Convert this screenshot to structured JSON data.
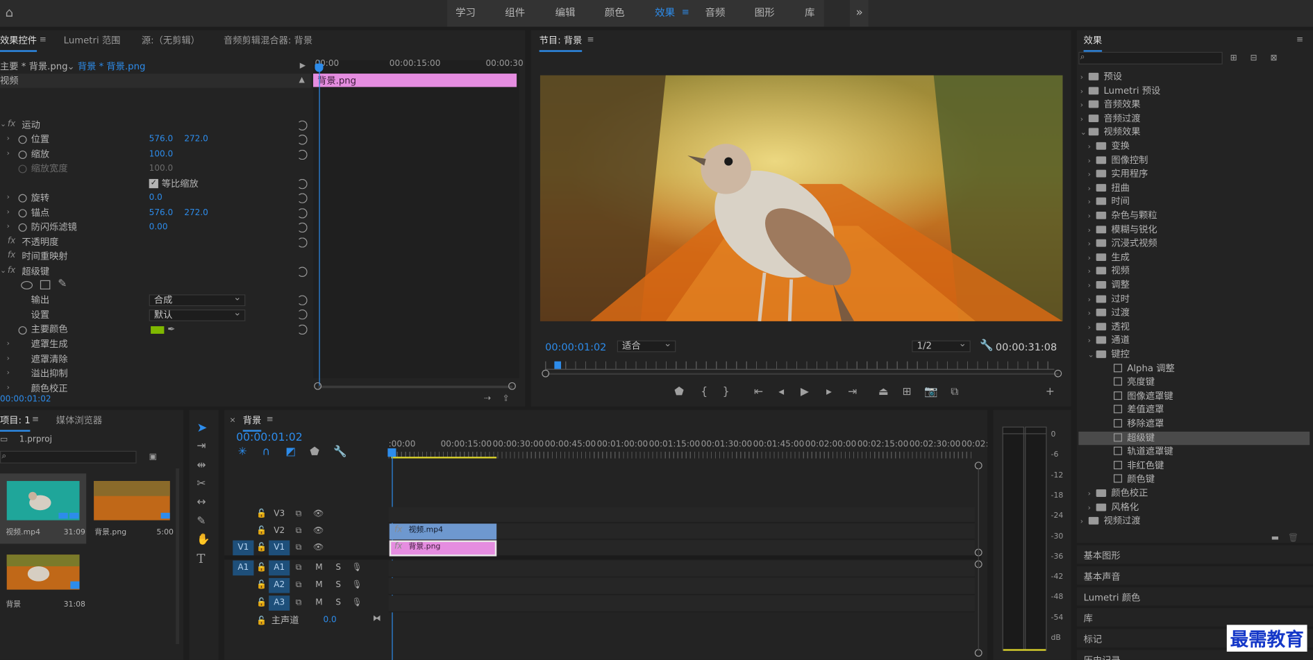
{
  "workspaces": [
    "学习",
    "组件",
    "编辑",
    "颜色",
    "效果",
    "音频",
    "图形",
    "库"
  ],
  "active_workspace": "效果",
  "more_workspaces": "»",
  "effect_controls": {
    "tabs": [
      "效果控件",
      "Lumetri 范围",
      "源:（无剪辑）",
      "音频剪辑混合器: 背景"
    ],
    "source_label": "主要 * 背景.png",
    "clip_label": "背景 * 背景.png",
    "ruler": [
      "00:00",
      "00:00:15:00",
      "00:00:30"
    ],
    "clip_bar": "背景.png",
    "section_video": "视频",
    "rows": [
      {
        "name": "运动",
        "fx": true
      },
      {
        "name": "位置",
        "v1": "576.0",
        "v2": "272.0"
      },
      {
        "name": "缩放",
        "v1": "100.0"
      },
      {
        "name": "缩放宽度",
        "v1": "100.0",
        "dim": true
      },
      {
        "name": "等比缩放",
        "checkbox": true
      },
      {
        "name": "旋转",
        "v1": "0.0"
      },
      {
        "name": "锚点",
        "v1": "576.0",
        "v2": "272.0"
      },
      {
        "name": "防闪烁滤镜",
        "v1": "0.00"
      },
      {
        "name": "不透明度",
        "fx": true
      },
      {
        "name": "时间重映射",
        "fx": true
      },
      {
        "name": "超级键",
        "fx": true
      }
    ],
    "output_label": "输出",
    "output_value": "合成",
    "setting_label": "设置",
    "setting_value": "默认",
    "key_color_label": "主要颜色",
    "sub_groups": [
      "遮罩生成",
      "遮罩清除",
      "溢出抑制",
      "颜色校正"
    ],
    "timecode": "00:00:01:02"
  },
  "program": {
    "title": "节目: 背景",
    "timecode": "00:00:01:02",
    "fit": "适合",
    "resolution": "1/2",
    "duration": "00:00:31:08"
  },
  "project": {
    "tabs": [
      "项目: 1",
      "媒体浏览器"
    ],
    "file": "1.prproj",
    "items": [
      {
        "name": "视频.mp4",
        "dur": "31:09"
      },
      {
        "name": "背景.png",
        "dur": "5:00"
      },
      {
        "name": "背景",
        "dur": "31:08"
      }
    ]
  },
  "timeline": {
    "tab": "背景",
    "timecode": "00:00:01:02",
    "ruler": [
      ":00:00",
      "00:00:15:00",
      "00:00:30:00",
      "00:00:45:00",
      "00:01:00:00",
      "00:01:15:00",
      "00:01:30:00",
      "00:01:45:00",
      "00:02:00:00",
      "00:02:15:00",
      "00:02:30:00",
      "00:02:45:"
    ],
    "video_tracks": [
      "V3",
      "V2",
      "V1"
    ],
    "audio_tracks": [
      "A1",
      "A2",
      "A3"
    ],
    "src_v": "V1",
    "src_a": "A1",
    "master": "主声道",
    "master_val": "0.0",
    "clip_video": "视频.mp4",
    "clip_png": "背景.png",
    "m": "M",
    "s": "S"
  },
  "meter": {
    "ticks": [
      "0",
      "-6",
      "-12",
      "-18",
      "-24",
      "-30",
      "-36",
      "-42",
      "-48",
      "-54",
      "dB"
    ]
  },
  "effects": {
    "title": "效果",
    "tree": [
      {
        "label": "预设",
        "lvl": 0,
        "t": "f",
        "o": false
      },
      {
        "label": "Lumetri 预设",
        "lvl": 0,
        "t": "f",
        "o": false
      },
      {
        "label": "音频效果",
        "lvl": 0,
        "t": "f",
        "o": false
      },
      {
        "label": "音频过渡",
        "lvl": 0,
        "t": "f",
        "o": false
      },
      {
        "label": "视频效果",
        "lvl": 0,
        "t": "f",
        "o": true
      },
      {
        "label": "变换",
        "lvl": 1,
        "t": "f",
        "o": false
      },
      {
        "label": "图像控制",
        "lvl": 1,
        "t": "f",
        "o": false
      },
      {
        "label": "实用程序",
        "lvl": 1,
        "t": "f",
        "o": false
      },
      {
        "label": "扭曲",
        "lvl": 1,
        "t": "f",
        "o": false
      },
      {
        "label": "时间",
        "lvl": 1,
        "t": "f",
        "o": false
      },
      {
        "label": "杂色与颗粒",
        "lvl": 1,
        "t": "f",
        "o": false
      },
      {
        "label": "模糊与锐化",
        "lvl": 1,
        "t": "f",
        "o": false
      },
      {
        "label": "沉浸式视频",
        "lvl": 1,
        "t": "f",
        "o": false
      },
      {
        "label": "生成",
        "lvl": 1,
        "t": "f",
        "o": false
      },
      {
        "label": "视频",
        "lvl": 1,
        "t": "f",
        "o": false
      },
      {
        "label": "调整",
        "lvl": 1,
        "t": "f",
        "o": false
      },
      {
        "label": "过时",
        "lvl": 1,
        "t": "f",
        "o": false
      },
      {
        "label": "过渡",
        "lvl": 1,
        "t": "f",
        "o": false
      },
      {
        "label": "透视",
        "lvl": 1,
        "t": "f",
        "o": false
      },
      {
        "label": "通道",
        "lvl": 1,
        "t": "f",
        "o": false
      },
      {
        "label": "键控",
        "lvl": 1,
        "t": "f",
        "o": true
      },
      {
        "label": "Alpha 调整",
        "lvl": 2,
        "t": "e"
      },
      {
        "label": "亮度键",
        "lvl": 2,
        "t": "e"
      },
      {
        "label": "图像遮罩键",
        "lvl": 2,
        "t": "e"
      },
      {
        "label": "差值遮罩",
        "lvl": 2,
        "t": "e"
      },
      {
        "label": "移除遮罩",
        "lvl": 2,
        "t": "e"
      },
      {
        "label": "超级键",
        "lvl": 2,
        "t": "e",
        "sel": true
      },
      {
        "label": "轨道遮罩键",
        "lvl": 2,
        "t": "e"
      },
      {
        "label": "非红色键",
        "lvl": 2,
        "t": "e"
      },
      {
        "label": "颜色键",
        "lvl": 2,
        "t": "e"
      },
      {
        "label": "颜色校正",
        "lvl": 1,
        "t": "f",
        "o": false
      },
      {
        "label": "风格化",
        "lvl": 1,
        "t": "f",
        "o": false
      },
      {
        "label": "视频过渡",
        "lvl": 0,
        "t": "f",
        "o": false
      }
    ],
    "sections": [
      "基本图形",
      "基本声音",
      "Lumetri 颜色",
      "库",
      "标记",
      "历史记录"
    ]
  },
  "watermark": "最需教育",
  "colors": {
    "accent": "#2d8ceb",
    "png_clip": "#e58de0",
    "video_clip": "#6e98cf",
    "key": "#7fb800"
  }
}
